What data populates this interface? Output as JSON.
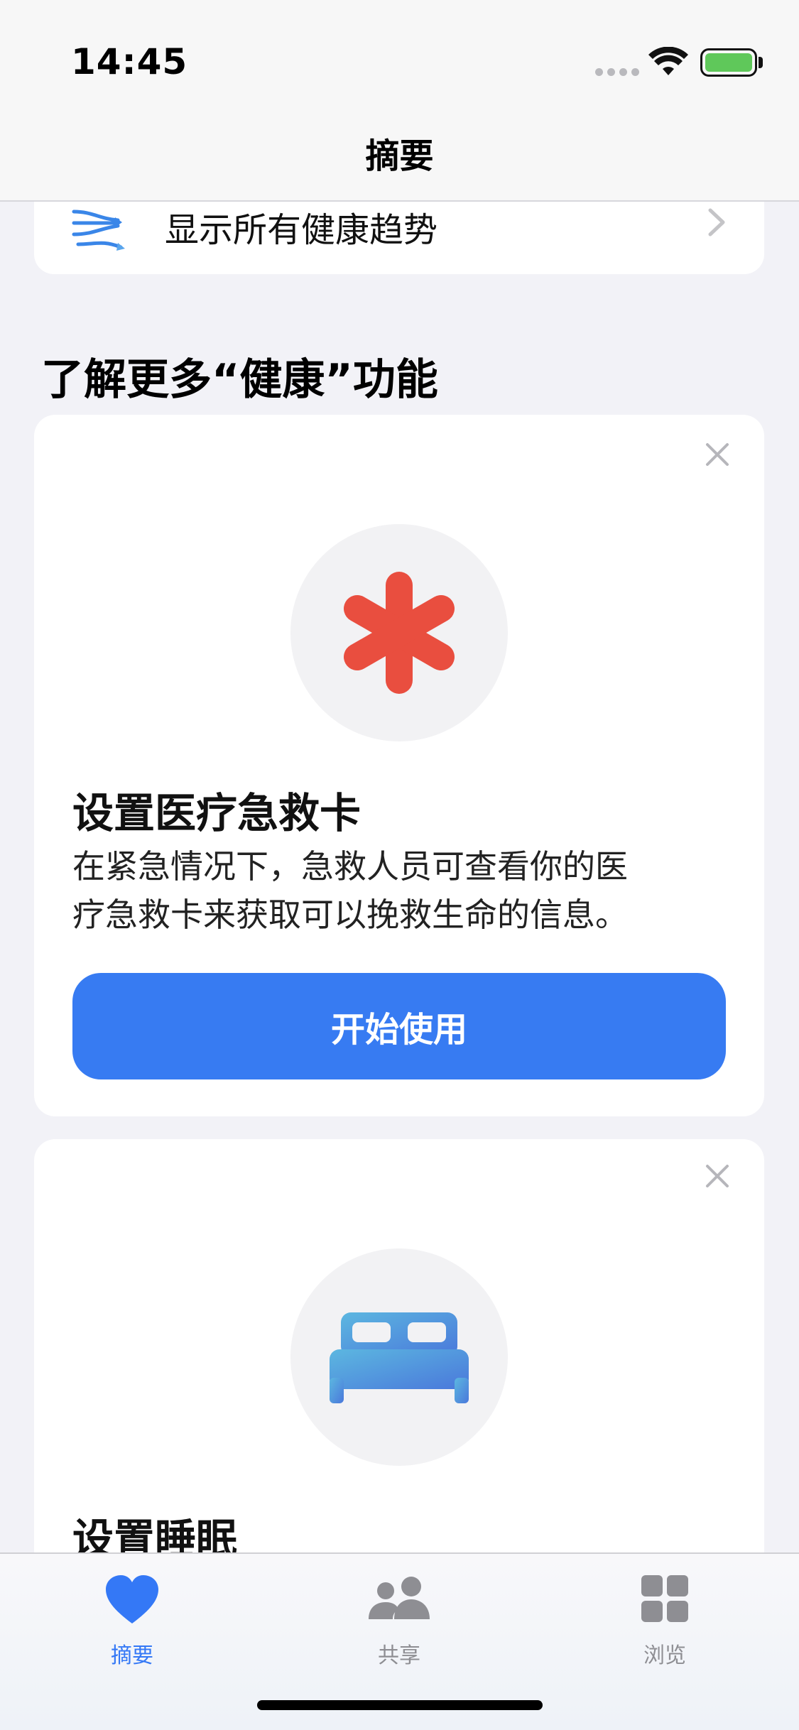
{
  "status_bar": {
    "time": "14:45"
  },
  "nav": {
    "title": "摘要"
  },
  "trends": {
    "label": "显示所有健康趋势",
    "icon": "trends-icon"
  },
  "section": {
    "title": "了解更多“健康”功能"
  },
  "cards": [
    {
      "icon": "medical-id-asterisk-icon",
      "title": "设置医疗急救卡",
      "description_line1": "在紧急情况下，急救人员可查看你的医",
      "description_line2": "疗急救卡来获取可以挽救生命的信息。",
      "button_label": "开始使用",
      "accent_color": "#e94e3f"
    },
    {
      "icon": "bed-icon",
      "title": "设置睡眠"
    }
  ],
  "tabbar": {
    "tabs": [
      {
        "label": "摘要",
        "icon": "heart-icon",
        "active": true
      },
      {
        "label": "共享",
        "icon": "people-icon",
        "active": false
      },
      {
        "label": "浏览",
        "icon": "grid-icon",
        "active": false
      }
    ]
  },
  "colors": {
    "accent": "#3478f6",
    "button": "#377bf2",
    "background": "#f2f2f7",
    "battery": "#5fc85a"
  }
}
